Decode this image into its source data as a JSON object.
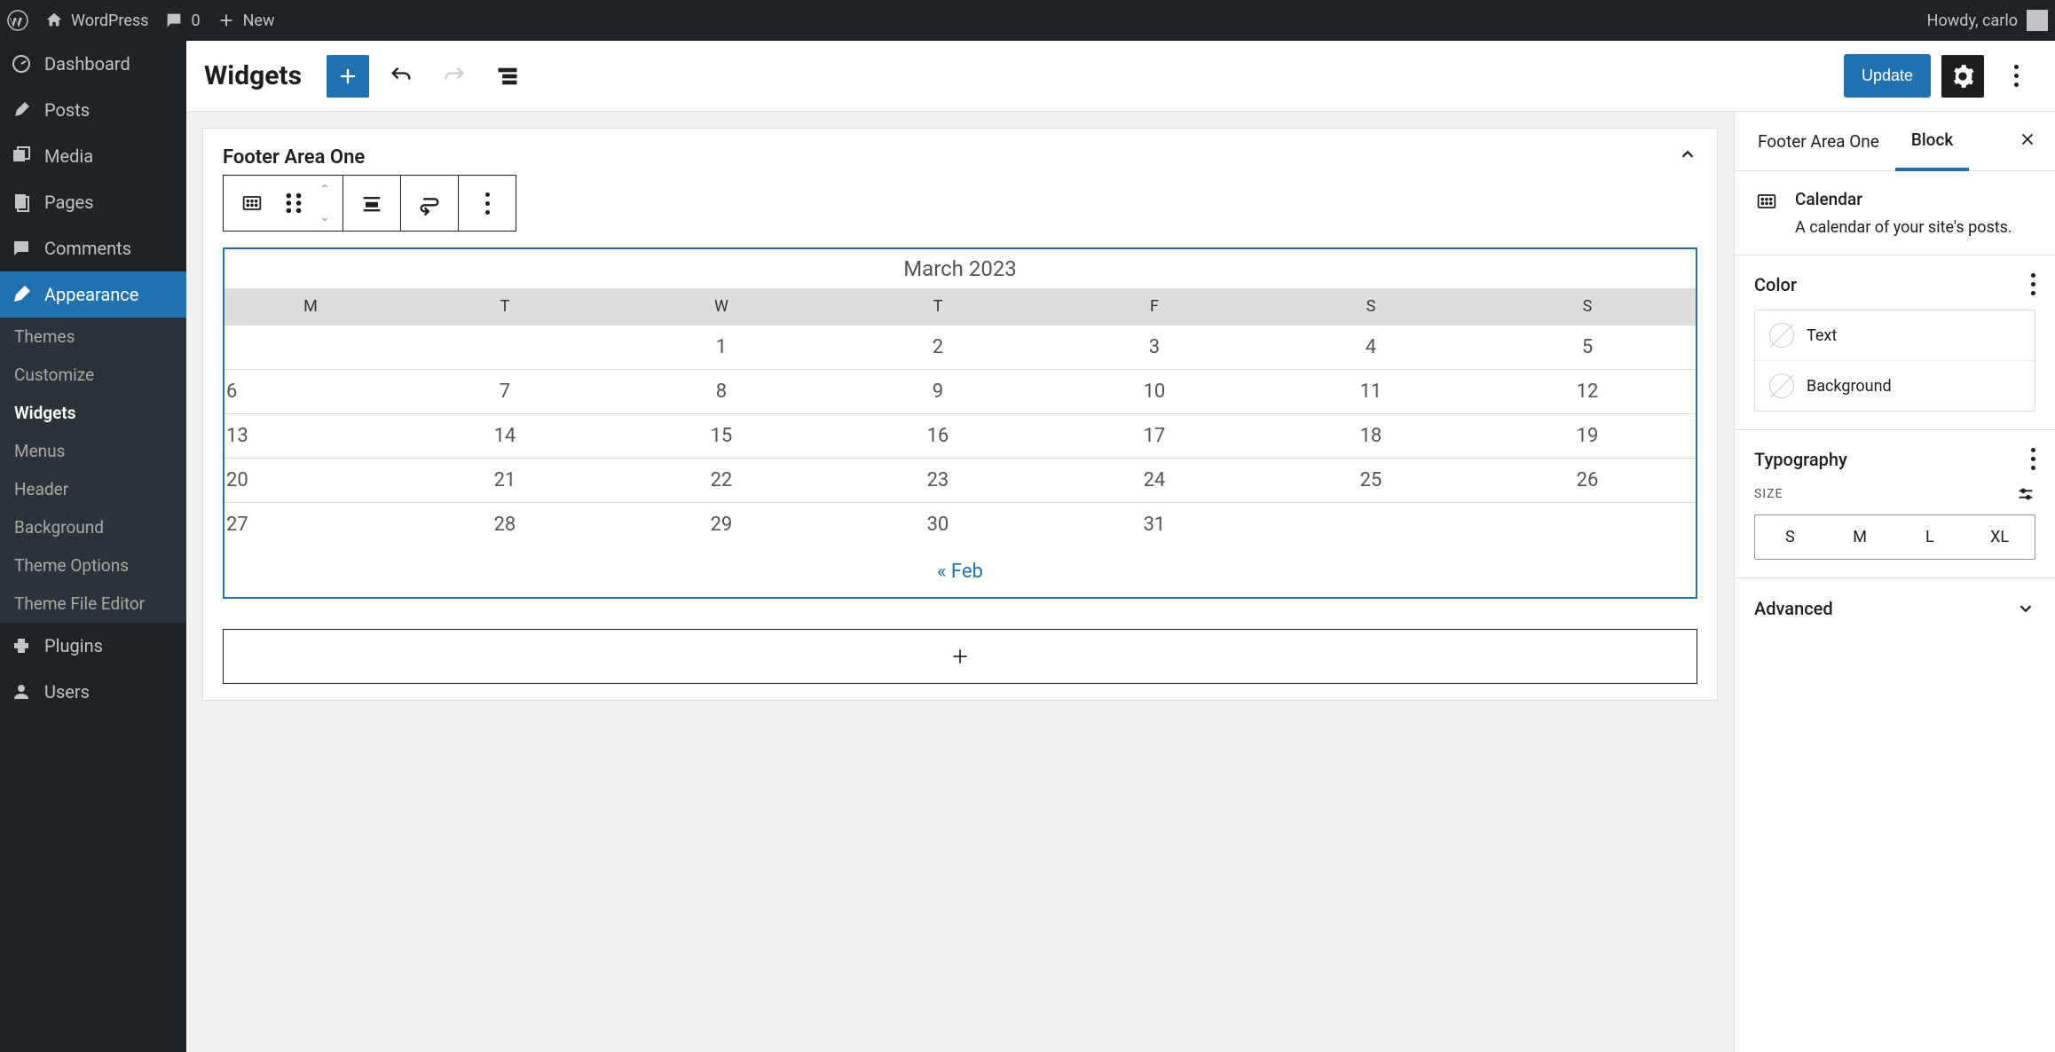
{
  "adminbar": {
    "sitename": "WordPress",
    "comments": "0",
    "new": "New",
    "howdy": "Howdy, carlo"
  },
  "sidebar": {
    "items": [
      {
        "label": "Dashboard"
      },
      {
        "label": "Posts"
      },
      {
        "label": "Media"
      },
      {
        "label": "Pages"
      },
      {
        "label": "Comments"
      },
      {
        "label": "Appearance"
      },
      {
        "label": "Plugins"
      },
      {
        "label": "Users"
      }
    ],
    "submenu": [
      {
        "label": "Themes"
      },
      {
        "label": "Customize"
      },
      {
        "label": "Widgets"
      },
      {
        "label": "Menus"
      },
      {
        "label": "Header"
      },
      {
        "label": "Background"
      },
      {
        "label": "Theme Options"
      },
      {
        "label": "Theme File Editor"
      }
    ]
  },
  "topbar": {
    "title": "Widgets",
    "update": "Update"
  },
  "widgetArea": {
    "title": "Footer Area One"
  },
  "calendar": {
    "caption": "March 2023",
    "days": [
      "M",
      "T",
      "W",
      "T",
      "F",
      "S",
      "S"
    ],
    "weeks": [
      [
        "",
        "",
        "1",
        "2",
        "3",
        "4",
        "5"
      ],
      [
        "6",
        "7",
        "8",
        "9",
        "10",
        "11",
        "12"
      ],
      [
        "13",
        "14",
        "15",
        "16",
        "17",
        "18",
        "19"
      ],
      [
        "20",
        "21",
        "22",
        "23",
        "24",
        "25",
        "26"
      ],
      [
        "27",
        "28",
        "29",
        "30",
        "31",
        "",
        ""
      ]
    ],
    "prev": "« Feb"
  },
  "inspector": {
    "tab1": "Footer Area One",
    "tab2": "Block",
    "block_title": "Calendar",
    "block_desc": "A calendar of your site's posts.",
    "color_heading": "Color",
    "color_text": "Text",
    "color_bg": "Background",
    "typo_heading": "Typography",
    "size_label": "SIZE",
    "sizes": [
      "S",
      "M",
      "L",
      "XL"
    ],
    "advanced": "Advanced"
  }
}
